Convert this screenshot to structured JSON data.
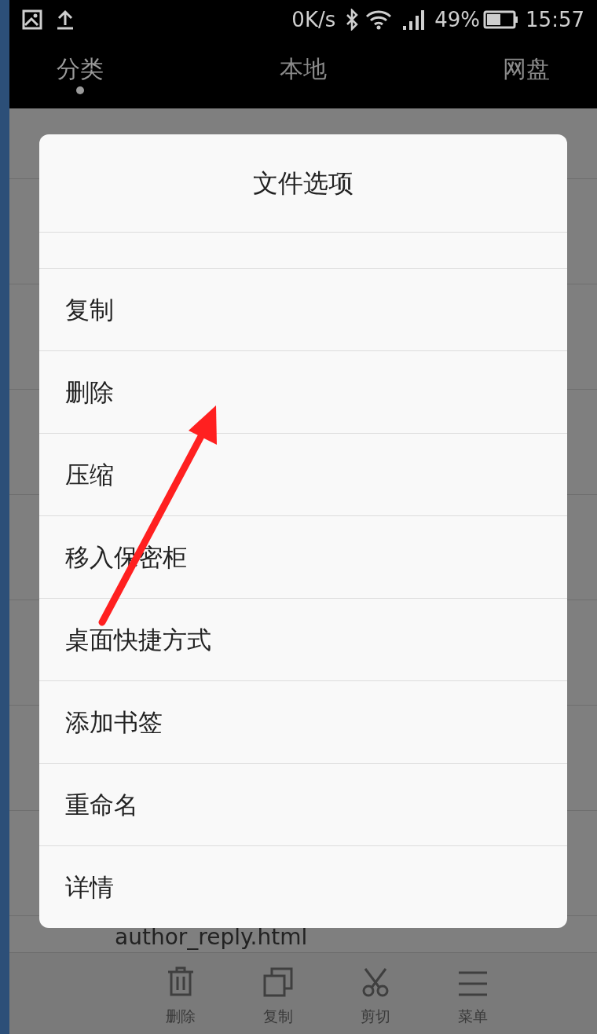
{
  "status_bar": {
    "speed": "0K/s",
    "battery": "49%",
    "time": "15:57"
  },
  "tabs": [
    {
      "label": "分类",
      "selected": true
    },
    {
      "label": "本地",
      "selected": false
    },
    {
      "label": "网盘",
      "selected": false
    }
  ],
  "background_list": {
    "visible_item": "author_reply.html"
  },
  "dialog": {
    "title": "文件选项",
    "items": [
      {
        "label": "复制"
      },
      {
        "label": "删除"
      },
      {
        "label": "压缩"
      },
      {
        "label": "移入保密柜"
      },
      {
        "label": "桌面快捷方式"
      },
      {
        "label": "添加书签"
      },
      {
        "label": "重命名"
      },
      {
        "label": "详情"
      }
    ]
  },
  "toolbar": [
    {
      "kind": "delete",
      "label": "删除"
    },
    {
      "kind": "copy",
      "label": "复制"
    },
    {
      "kind": "cut",
      "label": "剪切"
    },
    {
      "kind": "menu",
      "label": "菜单"
    }
  ]
}
